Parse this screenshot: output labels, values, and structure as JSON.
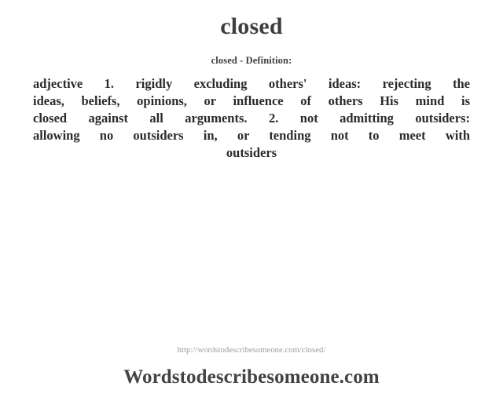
{
  "entry": {
    "word": "closed",
    "definition_heading": "closed - Definition:",
    "definition_lines": [
      "adjective 1. rigidly excluding others' ideas: rejecting the",
      "ideas, beliefs, opinions, or influence of others His mind is",
      "closed against all arguments. 2. not admitting outsiders:",
      "allowing no outsiders in, or tending not to meet with",
      "outsiders"
    ],
    "definition_full": "adjective 1. rigidly excluding others' ideas: rejecting the ideas, beliefs, opinions, or influence of others His mind is closed against all arguments. 2. not admitting outsiders: allowing no outsiders in, or tending not to meet with outsiders",
    "part_of_speech": "adjective",
    "senses": [
      {
        "number": "1.",
        "gloss": "rigidly excluding others' ideas:",
        "detail": "rejecting the ideas, beliefs, opinions, or influence of others",
        "example": "His mind is closed against all arguments."
      },
      {
        "number": "2.",
        "gloss": "not admitting outsiders:",
        "detail": "allowing no outsiders in, or tending not to meet with outsiders",
        "example": ""
      }
    ]
  },
  "footer": {
    "url": "http://wordstodescribesomeone.com/closed/",
    "site_name": "Wordstodescribesomeone.com"
  },
  "colors": {
    "background": "#ffffff",
    "title": "#3d3d3d",
    "body_text": "#2b2b2b",
    "url_text": "#9a9a9a",
    "brand_text": "#434343"
  }
}
